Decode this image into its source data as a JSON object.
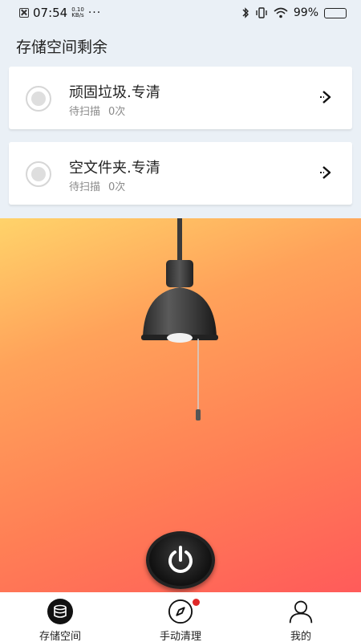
{
  "status_bar": {
    "time": "07:54",
    "speed_value": "0.10",
    "speed_unit": "KB/s",
    "more": "···",
    "battery": "99%"
  },
  "section_title": "存储空间剩余",
  "cards": [
    {
      "title": "顽固垃圾.专清",
      "status": "待扫描",
      "count": "0次"
    },
    {
      "title": "空文件夹.专清",
      "status": "待扫描",
      "count": "0次"
    }
  ],
  "tabs": [
    {
      "label": "存储空间",
      "icon": "database-icon",
      "active": true
    },
    {
      "label": "手动清理",
      "icon": "compass-icon",
      "badge": true
    },
    {
      "label": "我的",
      "icon": "user-icon"
    }
  ],
  "colors": {
    "gradient_start": "#ffd36a",
    "gradient_end": "#ff5b5a",
    "badge": "#e02828"
  }
}
